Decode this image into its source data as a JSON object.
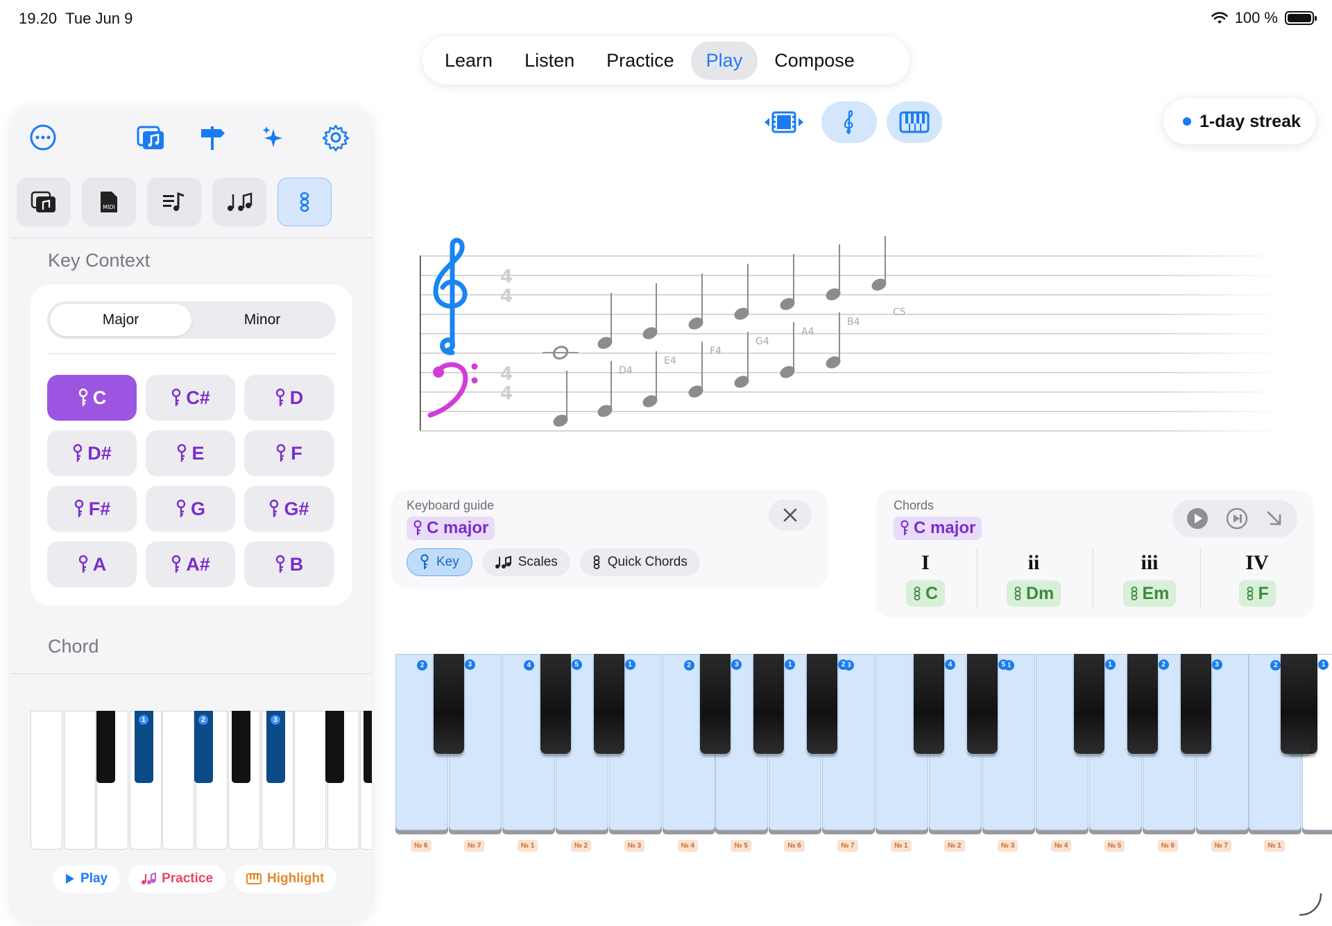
{
  "status": {
    "time": "19.20",
    "date": "Tue Jun 9",
    "battery": "100 %"
  },
  "nav": {
    "tabs": [
      "Learn",
      "Listen",
      "Practice",
      "Play",
      "Compose"
    ],
    "active": "Play"
  },
  "streak": {
    "label": "1-day streak"
  },
  "sidebar": {
    "toolbar_icons": [
      "more-icon",
      "music-library-icon",
      "signpost-icon",
      "sparkles-icon",
      "gear-icon"
    ],
    "source_icons": [
      "music-library-icon",
      "midi-file-icon",
      "playlist-icon",
      "notes-icon",
      "chord-icon"
    ],
    "key_context_title": "Key Context",
    "mode_options": [
      "Major",
      "Minor"
    ],
    "mode_selected": "Major",
    "keys": [
      "C",
      "C#",
      "D",
      "D#",
      "E",
      "F",
      "F#",
      "G",
      "G#",
      "A",
      "A#",
      "B"
    ],
    "key_selected": "C",
    "chord_title": "Chord",
    "chord_fingers": [
      "1",
      "2",
      "3"
    ],
    "chips": {
      "play": "Play",
      "practice": "Practice",
      "highlight": "Highlight"
    }
  },
  "staff": {
    "time_signature": [
      "4",
      "4"
    ],
    "treble_note_labels": [
      "D4",
      "E4",
      "F4",
      "G4",
      "A4",
      "B4",
      "C5"
    ]
  },
  "keyboard_guide": {
    "title": "Keyboard guide",
    "key_tag": "C major",
    "pills": [
      "Key",
      "Scales",
      "Quick Chords"
    ],
    "active_pill": "Key"
  },
  "chords": {
    "title": "Chords",
    "key_tag": "C major",
    "items": [
      {
        "roman": "I",
        "name": "C"
      },
      {
        "roman": "ii",
        "name": "Dm"
      },
      {
        "roman": "iii",
        "name": "Em"
      },
      {
        "roman": "IV",
        "name": "F"
      }
    ]
  },
  "big_keyboard": {
    "white_finger_labels": [
      "2",
      "",
      "4",
      "",
      "",
      "2",
      "",
      "",
      "3",
      "",
      "",
      "1",
      "",
      "",
      "",
      "",
      "2"
    ],
    "black_finger_labels": [
      "3",
      "5",
      "1",
      "3",
      "1",
      "2",
      "4",
      "5",
      "1",
      "2",
      "3",
      "1",
      ""
    ],
    "degree_labels": [
      "№ 6",
      "№ 7",
      "№ 1",
      "№ 2",
      "№ 3",
      "№ 4",
      "№ 5",
      "№ 6",
      "№ 7",
      "№ 1",
      "№ 2",
      "№ 3",
      "№ 4",
      "№ 5",
      "№ 6",
      "№ 7",
      "№ 1"
    ]
  }
}
